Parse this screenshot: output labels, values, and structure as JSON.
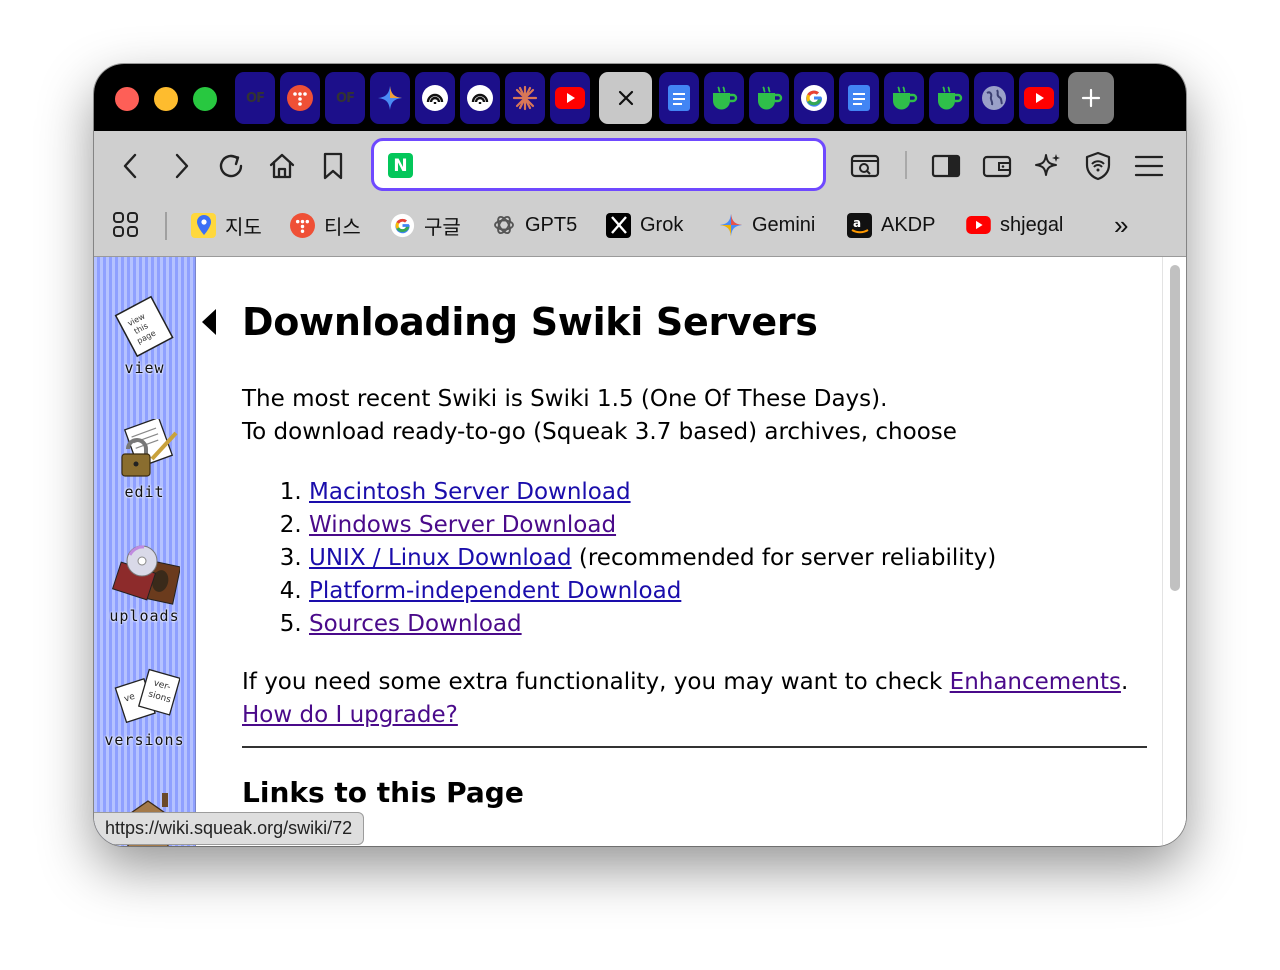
{
  "browser": {
    "tabs": [
      {
        "name": "OF"
      },
      {
        "name": "티스토리"
      },
      {
        "name": "OF"
      },
      {
        "name": "Gemini"
      },
      {
        "name": "Perplexity"
      },
      {
        "name": "Perplexity"
      },
      {
        "name": "Claude"
      },
      {
        "name": "YouTube"
      },
      {
        "name": "close-current"
      },
      {
        "name": "Docs"
      },
      {
        "name": "Cup"
      },
      {
        "name": "Cup"
      },
      {
        "name": "Google"
      },
      {
        "name": "Docs"
      },
      {
        "name": "Cup"
      },
      {
        "name": "Cup"
      },
      {
        "name": "Globe"
      },
      {
        "name": "YouTube"
      }
    ],
    "new_tab_label": "+",
    "url": "",
    "site_icon_letter": "N",
    "bookmarks": [
      {
        "label": "지도",
        "icon": "map-pin-icon"
      },
      {
        "label": "티스",
        "icon": "tistory-icon"
      },
      {
        "label": "구글",
        "icon": "google-icon"
      },
      {
        "label": "GPT5",
        "icon": "openai-icon"
      },
      {
        "label": "Grok",
        "icon": "x-icon"
      },
      {
        "label": "Gemini",
        "icon": "gemini-icon"
      },
      {
        "label": "AKDP",
        "icon": "amazon-icon"
      },
      {
        "label": "shjegal",
        "icon": "youtube-icon"
      }
    ],
    "more_bookmarks": "»",
    "status_url": "https://wiki.squeak.org/swiki/72"
  },
  "sidebar": {
    "items": [
      {
        "label": "view",
        "icon": "view-page-icon"
      },
      {
        "label": "edit",
        "icon": "edit-lock-icon"
      },
      {
        "label": "uploads",
        "icon": "uploads-icon"
      },
      {
        "label": "versions",
        "icon": "versions-icon"
      }
    ]
  },
  "page": {
    "title": "Downloading Swiki Servers",
    "intro_line1": "The most recent Swiki is Swiki 1.5 (One Of These Days).",
    "intro_line2": "To download ready-to-go (Squeak 3.7 based) archives, choose",
    "downloads": [
      {
        "link": "Macintosh Server Download",
        "note": ""
      },
      {
        "link": "Windows Server Download",
        "note": ""
      },
      {
        "link": "UNIX / Linux Download",
        "note": " (recommended for server reliability)"
      },
      {
        "link": "Platform-independent Download",
        "note": ""
      },
      {
        "link": "Sources Download",
        "note": ""
      }
    ],
    "extra_text": "If you need some extra functionality, you may want to check ",
    "extra_link": "Enhancements",
    "extra_end": ".",
    "upgrade_link": "How do I upgrade?",
    "links_heading": "Links to this Page"
  },
  "colors": {
    "accent": "#6f49ff",
    "tab_bg": "#1c0f8a",
    "link": "#1a0dab",
    "visited_link": "#4a0a8a",
    "sidebar_stripe_light": "#b5c2ff",
    "sidebar_stripe_dark": "#8fa0ff"
  }
}
